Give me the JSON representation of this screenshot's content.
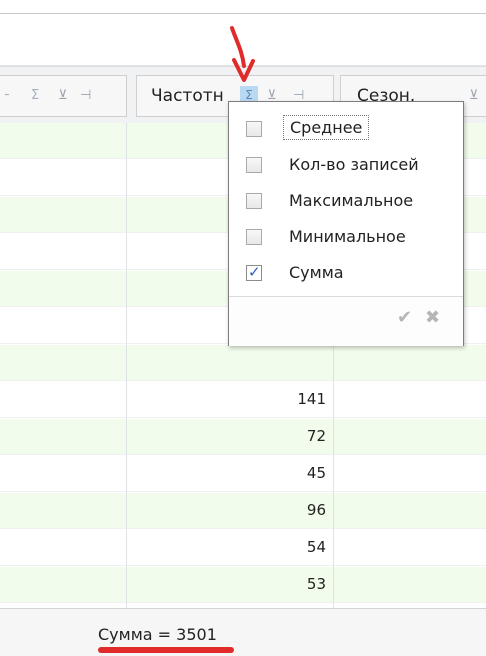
{
  "header": {
    "col1_icons": [
      "sigma-icon",
      "filter-icon",
      "pin-icon"
    ],
    "col2_label": "Частотн",
    "col3_label": "Сезон."
  },
  "rows": [
    {
      "value": ""
    },
    {
      "value": ""
    },
    {
      "value": ""
    },
    {
      "value": ""
    },
    {
      "value": ""
    },
    {
      "value": ""
    },
    {
      "value": ""
    },
    {
      "value": "141"
    },
    {
      "value": "72"
    },
    {
      "value": "45"
    },
    {
      "value": "96"
    },
    {
      "value": "54"
    },
    {
      "value": "53"
    }
  ],
  "popup": {
    "options": [
      {
        "label": "Среднее",
        "checked": false
      },
      {
        "label": "Кол-во записей",
        "checked": false
      },
      {
        "label": "Максимальное",
        "checked": false
      },
      {
        "label": "Минимальное",
        "checked": false
      },
      {
        "label": "Сумма",
        "checked": true
      }
    ]
  },
  "footer": {
    "summary": "Сумма = 3501"
  },
  "colors": {
    "alt_row": "#f2fcec",
    "arrow": "#e12b2b",
    "checkmark": "#2b5fbd"
  }
}
